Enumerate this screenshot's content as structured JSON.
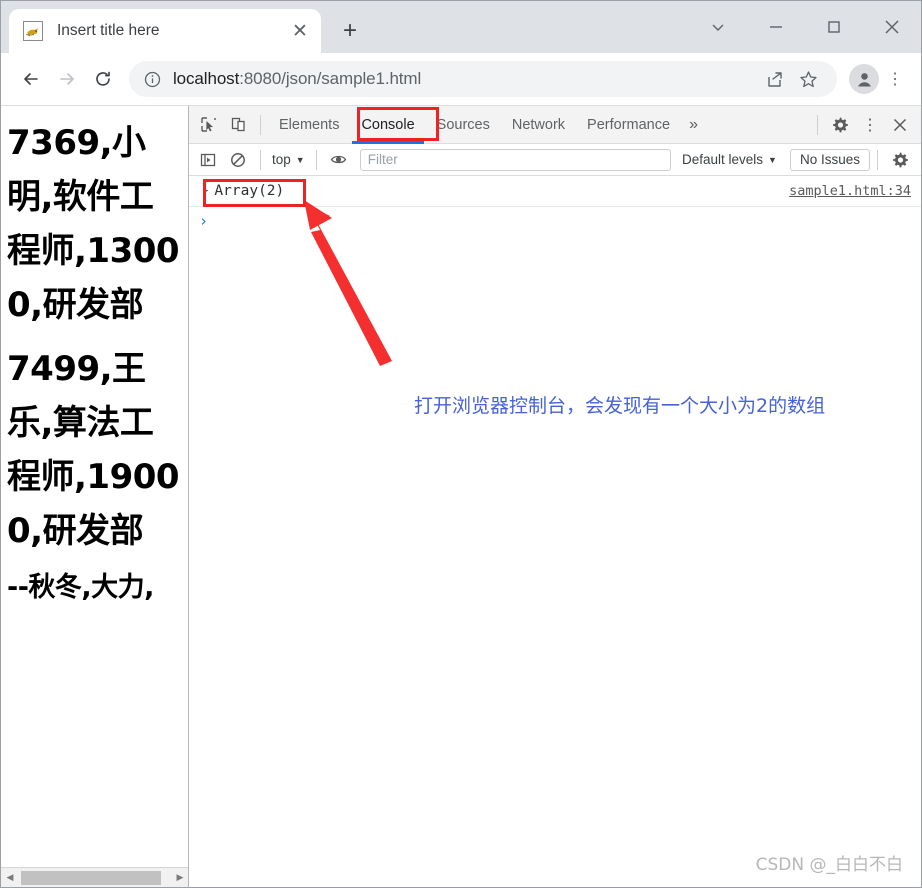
{
  "browser": {
    "tab": {
      "title": "Insert title here",
      "favicon": "tomcat-icon",
      "close_label": "✕"
    },
    "new_tab_label": "+",
    "window_controls": [
      {
        "name": "tab-search-button",
        "glyph": "⌄"
      },
      {
        "name": "minimize-button",
        "glyph": "—"
      },
      {
        "name": "maximize-button",
        "glyph": "□"
      },
      {
        "name": "close-window-button",
        "glyph": "✕"
      }
    ],
    "toolbar": {
      "back_label": "←",
      "forward_label": "→",
      "reload_label": "↻",
      "url_host": "localhost",
      "url_path": ":8080/json/sample1.html",
      "url_full": "localhost:8080/json/sample1.html",
      "share_label": "share-icon",
      "bookmark_label": "star-icon",
      "profile_label": "profile-avatar",
      "menu_label": "⋮"
    }
  },
  "page": {
    "lines": [
      "7369,小明,软件工程师,13000,研发部",
      "7499,王乐,算法工程师,19000,研发部"
    ],
    "footer_line": "--秋冬,大力,",
    "scroll_left_arrow": "◀",
    "scroll_right_arrow": "▶"
  },
  "devtools": {
    "left_icons": [
      {
        "name": "inspect-element-icon"
      },
      {
        "name": "device-toolbar-icon"
      }
    ],
    "tabs": [
      {
        "label": "Elements",
        "active": false
      },
      {
        "label": "Console",
        "active": true
      },
      {
        "label": "Sources",
        "active": false
      },
      {
        "label": "Network",
        "active": false
      },
      {
        "label": "Performance",
        "active": false
      }
    ],
    "more_tabs_label": "»",
    "settings_label": "gear-icon",
    "kebab_label": "⋮",
    "close_label": "✕",
    "filterbar": {
      "sidebar_toggle": "console-sidebar-icon",
      "clear_console": "clear-console-icon",
      "context": "top",
      "caret": "▼",
      "eye_label": "live-expressions-icon",
      "filter_placeholder": "Filter",
      "filter_value": "",
      "levels": "Default levels",
      "issues": "No Issues",
      "settings_label": "gear-icon"
    },
    "console": {
      "rows": [
        {
          "disclosure": "▶",
          "text": "Array(2)",
          "source": "sample1.html:34"
        }
      ],
      "prompt": "›"
    }
  },
  "annotations": {
    "callout_text": "打开浏览器控制台，会发现有一个大小为2的数组",
    "highlight_color": "#ee2222",
    "text_color": "#4662d6",
    "arrow_color": "#f42f2f",
    "boxes": [
      {
        "name": "console-tab-highlight"
      },
      {
        "name": "array-output-highlight"
      }
    ]
  },
  "watermark": "CSDN @_白白不白"
}
